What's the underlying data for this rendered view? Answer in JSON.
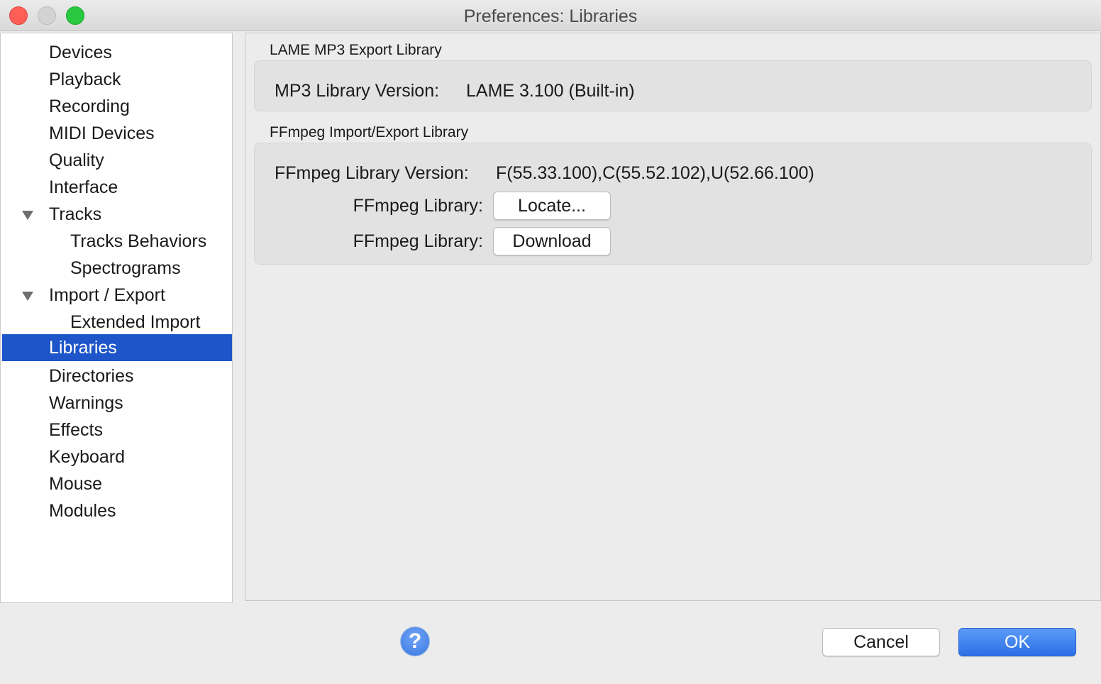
{
  "window": {
    "title": "Preferences: Libraries"
  },
  "sidebar": {
    "items": [
      {
        "label": "Devices"
      },
      {
        "label": "Playback"
      },
      {
        "label": "Recording"
      },
      {
        "label": "MIDI Devices"
      },
      {
        "label": "Quality"
      },
      {
        "label": "Interface"
      },
      {
        "label": "Tracks",
        "expanded": true
      },
      {
        "label": "Tracks Behaviors",
        "child": true
      },
      {
        "label": "Spectrograms",
        "child": true
      },
      {
        "label": "Import / Export",
        "expanded": true
      },
      {
        "label": "Extended Import",
        "child": true
      },
      {
        "label": "Libraries",
        "selected": true
      },
      {
        "label": "Directories"
      },
      {
        "label": "Warnings"
      },
      {
        "label": "Effects"
      },
      {
        "label": "Keyboard"
      },
      {
        "label": "Mouse"
      },
      {
        "label": "Modules"
      }
    ]
  },
  "lame": {
    "group_title": "LAME MP3 Export Library",
    "version_label": "MP3 Library Version:",
    "version_value": "LAME 3.100 (Built-in)"
  },
  "ffmpeg": {
    "group_title": "FFmpeg Import/Export Library",
    "version_label": "FFmpeg Library Version:",
    "version_value": "F(55.33.100),C(55.52.102),U(52.66.100)",
    "locate_label": "FFmpeg Library:",
    "locate_button": "Locate...",
    "download_label": "FFmpeg Library:",
    "download_button": "Download"
  },
  "footer": {
    "help_symbol": "?",
    "cancel": "Cancel",
    "ok": "OK"
  },
  "colors": {
    "selection": "#1e55c8",
    "default_button": "#2c6fe6"
  },
  "icons": [
    "close-window-icon",
    "minimize-window-icon",
    "zoom-window-icon",
    "disclosure-triangle-icon",
    "help-icon"
  ]
}
